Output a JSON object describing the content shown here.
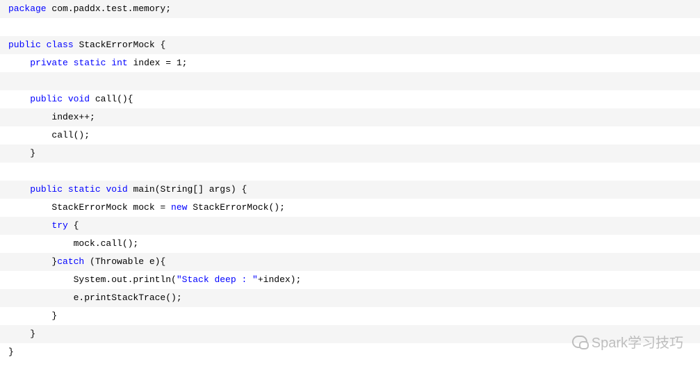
{
  "code": {
    "lines": [
      {
        "bg": "a",
        "tokens": [
          {
            "cls": "kw",
            "t": "package"
          },
          {
            "cls": "plain",
            "t": " com.paddx.test.memory;"
          }
        ]
      },
      {
        "bg": "b",
        "tokens": [
          {
            "cls": "plain",
            "t": ""
          }
        ]
      },
      {
        "bg": "a",
        "tokens": [
          {
            "cls": "kw",
            "t": "public"
          },
          {
            "cls": "plain",
            "t": " "
          },
          {
            "cls": "kw",
            "t": "class"
          },
          {
            "cls": "plain",
            "t": " StackErrorMock {"
          }
        ]
      },
      {
        "bg": "b",
        "tokens": [
          {
            "cls": "plain",
            "t": "    "
          },
          {
            "cls": "kw",
            "t": "private"
          },
          {
            "cls": "plain",
            "t": " "
          },
          {
            "cls": "kw",
            "t": "static"
          },
          {
            "cls": "plain",
            "t": " "
          },
          {
            "cls": "kw",
            "t": "int"
          },
          {
            "cls": "plain",
            "t": " index = 1;"
          }
        ]
      },
      {
        "bg": "a",
        "tokens": [
          {
            "cls": "plain",
            "t": ""
          }
        ]
      },
      {
        "bg": "b",
        "tokens": [
          {
            "cls": "plain",
            "t": "    "
          },
          {
            "cls": "kw",
            "t": "public"
          },
          {
            "cls": "plain",
            "t": " "
          },
          {
            "cls": "kw",
            "t": "void"
          },
          {
            "cls": "plain",
            "t": " call(){"
          }
        ]
      },
      {
        "bg": "a",
        "tokens": [
          {
            "cls": "plain",
            "t": "        index++;"
          }
        ]
      },
      {
        "bg": "b",
        "tokens": [
          {
            "cls": "plain",
            "t": "        call();"
          }
        ]
      },
      {
        "bg": "a",
        "tokens": [
          {
            "cls": "plain",
            "t": "    }"
          }
        ]
      },
      {
        "bg": "b",
        "tokens": [
          {
            "cls": "plain",
            "t": ""
          }
        ]
      },
      {
        "bg": "a",
        "tokens": [
          {
            "cls": "plain",
            "t": "    "
          },
          {
            "cls": "kw",
            "t": "public"
          },
          {
            "cls": "plain",
            "t": " "
          },
          {
            "cls": "kw",
            "t": "static"
          },
          {
            "cls": "plain",
            "t": " "
          },
          {
            "cls": "kw",
            "t": "void"
          },
          {
            "cls": "plain",
            "t": " main(String[] args) {"
          }
        ]
      },
      {
        "bg": "b",
        "tokens": [
          {
            "cls": "plain",
            "t": "        StackErrorMock mock = "
          },
          {
            "cls": "kw",
            "t": "new"
          },
          {
            "cls": "plain",
            "t": " StackErrorMock();"
          }
        ]
      },
      {
        "bg": "a",
        "tokens": [
          {
            "cls": "plain",
            "t": "        "
          },
          {
            "cls": "kw",
            "t": "try"
          },
          {
            "cls": "plain",
            "t": " {"
          }
        ]
      },
      {
        "bg": "b",
        "tokens": [
          {
            "cls": "plain",
            "t": "            mock.call();"
          }
        ]
      },
      {
        "bg": "a",
        "tokens": [
          {
            "cls": "plain",
            "t": "        }"
          },
          {
            "cls": "kw",
            "t": "catch"
          },
          {
            "cls": "plain",
            "t": " (Throwable e){"
          }
        ]
      },
      {
        "bg": "b",
        "tokens": [
          {
            "cls": "plain",
            "t": "            System.out.println("
          },
          {
            "cls": "str",
            "t": "\"Stack deep : \""
          },
          {
            "cls": "plain",
            "t": "+index);"
          }
        ]
      },
      {
        "bg": "a",
        "tokens": [
          {
            "cls": "plain",
            "t": "            e.printStackTrace();"
          }
        ]
      },
      {
        "bg": "b",
        "tokens": [
          {
            "cls": "plain",
            "t": "        }"
          }
        ]
      },
      {
        "bg": "a",
        "tokens": [
          {
            "cls": "plain",
            "t": "    }"
          }
        ]
      },
      {
        "bg": "b",
        "tokens": [
          {
            "cls": "plain",
            "t": "}"
          }
        ]
      }
    ]
  },
  "watermark": {
    "text": "Spark学习技巧"
  }
}
